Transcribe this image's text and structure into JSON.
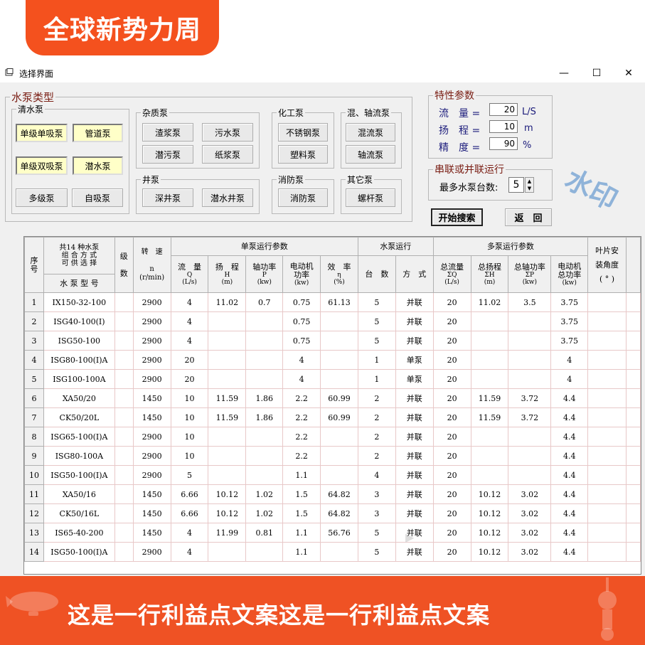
{
  "banner_top": {
    "text": "全球新势力周"
  },
  "window": {
    "title": "选择界面",
    "buttons": {
      "minimize": "—",
      "maximize": "☐",
      "close": "✕"
    }
  },
  "pump_types": {
    "legend": "水泵类型",
    "clear": {
      "legend": "清水泵",
      "items": [
        "单级单吸泵",
        "管道泵",
        "单级双吸泵",
        "潜水泵",
        "多级泵",
        "自吸泵"
      ]
    },
    "impurity": {
      "legend": "杂质泵",
      "items": [
        "渣浆泵",
        "污水泵",
        "潜污泵",
        "纸浆泵"
      ]
    },
    "chemical": {
      "legend": "化工泵",
      "items": [
        "不锈钢泵",
        "塑料泵"
      ]
    },
    "mixed": {
      "legend": "混、轴流泵",
      "items": [
        "混流泵",
        "轴流泵"
      ]
    },
    "well": {
      "legend": "井泵",
      "items": [
        "深井泵",
        "潜水井泵"
      ]
    },
    "fire": {
      "legend": "消防泵",
      "items": [
        "消防泵"
      ]
    },
    "other": {
      "legend": "其它泵",
      "items": [
        "螺杆泵"
      ]
    }
  },
  "params": {
    "legend": "特性参数",
    "flow": {
      "label": "流　量 =",
      "value": "20",
      "unit": "L/S"
    },
    "head": {
      "label": "扬　程 =",
      "value": "10",
      "unit": "m"
    },
    "accuracy": {
      "label": "精　度 =",
      "value": "90",
      "unit": "%"
    }
  },
  "series": {
    "legend": "串联或并联运行",
    "max_label": "最多水泵台数:",
    "max_value": "5"
  },
  "actions": {
    "search": "开始搜索",
    "back": "返　回"
  },
  "table": {
    "hdr": {
      "seq": "序\n号",
      "combo_top": "共14 种水泵\n组 合 方 式\n可 供 选 择",
      "model": "水 泵 型 号",
      "stage": "级\n\n数",
      "speed": "转　速\n\nn\n(r/min)",
      "single": "单泵运行参数",
      "flow": "流　量",
      "flow_sub": "Q\n(L/s)",
      "head": "扬　程",
      "head_sub": "H\n(m)",
      "shaft": "轴功率",
      "shaft_sub": "P\n(kw)",
      "motor": "电动机\n功率",
      "motor_sub": "(kw)",
      "eff": "效　率",
      "eff_sub": "η\n(%)",
      "run": "水泵运行",
      "count": "台　数",
      "mode": "方　式",
      "multi": "多泵运行参数",
      "tflow": "总流量",
      "tflow_sub": "ΣQ\n(L/s)",
      "thead": "总扬程",
      "thead_sub": "ΣH\n(m)",
      "tshaft": "总轴功率",
      "tshaft_sub": "ΣP\n(kw)",
      "tmotor": "电动机\n总功率",
      "tmotor_sub": "(kw)",
      "blade": "叶片安\n\n装角度\n\n( ° )"
    },
    "rows": [
      [
        "1",
        "IX150-32-100",
        "",
        "2900",
        "4",
        "11.02",
        "0.7",
        "0.75",
        "61.13",
        "5",
        "并联",
        "20",
        "11.02",
        "3.5",
        "3.75"
      ],
      [
        "2",
        "ISG40-100(I)",
        "",
        "2900",
        "4",
        "",
        "",
        "0.75",
        "",
        "5",
        "并联",
        "20",
        "",
        "",
        "3.75"
      ],
      [
        "3",
        "ISG50-100",
        "",
        "2900",
        "4",
        "",
        "",
        "0.75",
        "",
        "5",
        "并联",
        "20",
        "",
        "",
        "3.75"
      ],
      [
        "4",
        "ISG80-100(I)A",
        "",
        "2900",
        "20",
        "",
        "",
        "4",
        "",
        "1",
        "单泵",
        "20",
        "",
        "",
        "4"
      ],
      [
        "5",
        "ISG100-100A",
        "",
        "2900",
        "20",
        "",
        "",
        "4",
        "",
        "1",
        "单泵",
        "20",
        "",
        "",
        "4"
      ],
      [
        "6",
        "XA50/20",
        "",
        "1450",
        "10",
        "11.59",
        "1.86",
        "2.2",
        "60.99",
        "2",
        "并联",
        "20",
        "11.59",
        "3.72",
        "4.4"
      ],
      [
        "7",
        "CK50/20L",
        "",
        "1450",
        "10",
        "11.59",
        "1.86",
        "2.2",
        "60.99",
        "2",
        "并联",
        "20",
        "11.59",
        "3.72",
        "4.4"
      ],
      [
        "8",
        "ISG65-100(I)A",
        "",
        "2900",
        "10",
        "",
        "",
        "2.2",
        "",
        "2",
        "并联",
        "20",
        "",
        "",
        "4.4"
      ],
      [
        "9",
        "ISG80-100A",
        "",
        "2900",
        "10",
        "",
        "",
        "2.2",
        "",
        "2",
        "并联",
        "20",
        "",
        "",
        "4.4"
      ],
      [
        "10",
        "ISG50-100(I)A",
        "",
        "2900",
        "5",
        "",
        "",
        "1.1",
        "",
        "4",
        "并联",
        "20",
        "",
        "",
        "4.4"
      ],
      [
        "11",
        "XA50/16",
        "",
        "1450",
        "6.66",
        "10.12",
        "1.02",
        "1.5",
        "64.82",
        "3",
        "并联",
        "20",
        "10.12",
        "3.02",
        "4.4"
      ],
      [
        "12",
        "CK50/16L",
        "",
        "1450",
        "6.66",
        "10.12",
        "1.02",
        "1.5",
        "64.82",
        "3",
        "并联",
        "20",
        "10.12",
        "3.02",
        "4.4"
      ],
      [
        "13",
        "IS65-40-200",
        "",
        "1450",
        "4",
        "11.99",
        "0.81",
        "1.1",
        "56.76",
        "5",
        "并联",
        "20",
        "10.12",
        "3.02",
        "4.4"
      ],
      [
        "14",
        "ISG50-100(I)A",
        "",
        "2900",
        "4",
        "",
        "",
        "1.1",
        "",
        "5",
        "并联",
        "20",
        "10.12",
        "3.02",
        "4.4"
      ]
    ]
  },
  "banner_bottom": {
    "text": "这是一行利益点文案这是一行利益点文案"
  },
  "colors": {
    "banner": "#f4511e",
    "button_yellow": "#ffffc8",
    "legend_red": "#7a1e14",
    "param_blue": "#1a1a7a"
  }
}
